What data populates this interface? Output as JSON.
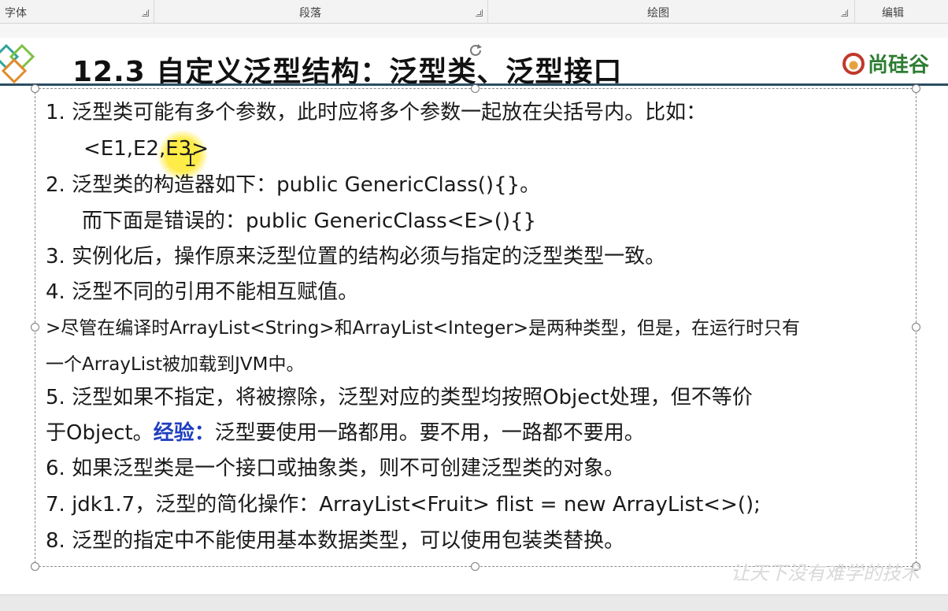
{
  "ribbon": {
    "groups": [
      {
        "label": "字体"
      },
      {
        "label": "段落"
      },
      {
        "label": "绘图"
      },
      {
        "label": "编辑"
      }
    ]
  },
  "slide": {
    "title": "12.3 自定义泛型结构：泛型类、泛型接口",
    "logo_text": "尚硅谷",
    "lines": [
      "1.  泛型类可能有多个参数，此时应将多个参数一起放在尖括号内。比如：",
      "<E1,E2,E3>",
      "2.  泛型类的构造器如下：public GenericClass(){}。",
      "而下面是错误的：public GenericClass<E>(){}",
      "3. 实例化后，操作原来泛型位置的结构必须与指定的泛型类型一致。",
      "4. 泛型不同的引用不能相互赋值。",
      ">尽管在编译时ArrayList<String>和ArrayList<Integer>是两种类型，但是，在运行时只有",
      "一个ArrayList被加载到JVM中。",
      "5. 泛型如果不指定，将被擦除，泛型对应的类型均按照Object处理，但不等价",
      "于Object。",
      "经验：",
      "泛型要使用一路都用。要不用，一路都不要用。",
      "6. 如果泛型类是一个接口或抽象类，则不可创建泛型类的对象。",
      "7. jdk1.7，泛型的简化操作：ArrayList<Fruit> flist = new ArrayList<>();",
      "8. 泛型的指定中不能使用基本数据类型，可以使用包装类替换。"
    ],
    "watermark": "让天下没有难学的技术"
  },
  "colors": {
    "title_rule": "#2b4e63",
    "highlight": "#1f3fbf",
    "logo_ring": "#c0392b",
    "logo_text": "#2e7d32",
    "cursor_glow": "#ffee3c"
  }
}
